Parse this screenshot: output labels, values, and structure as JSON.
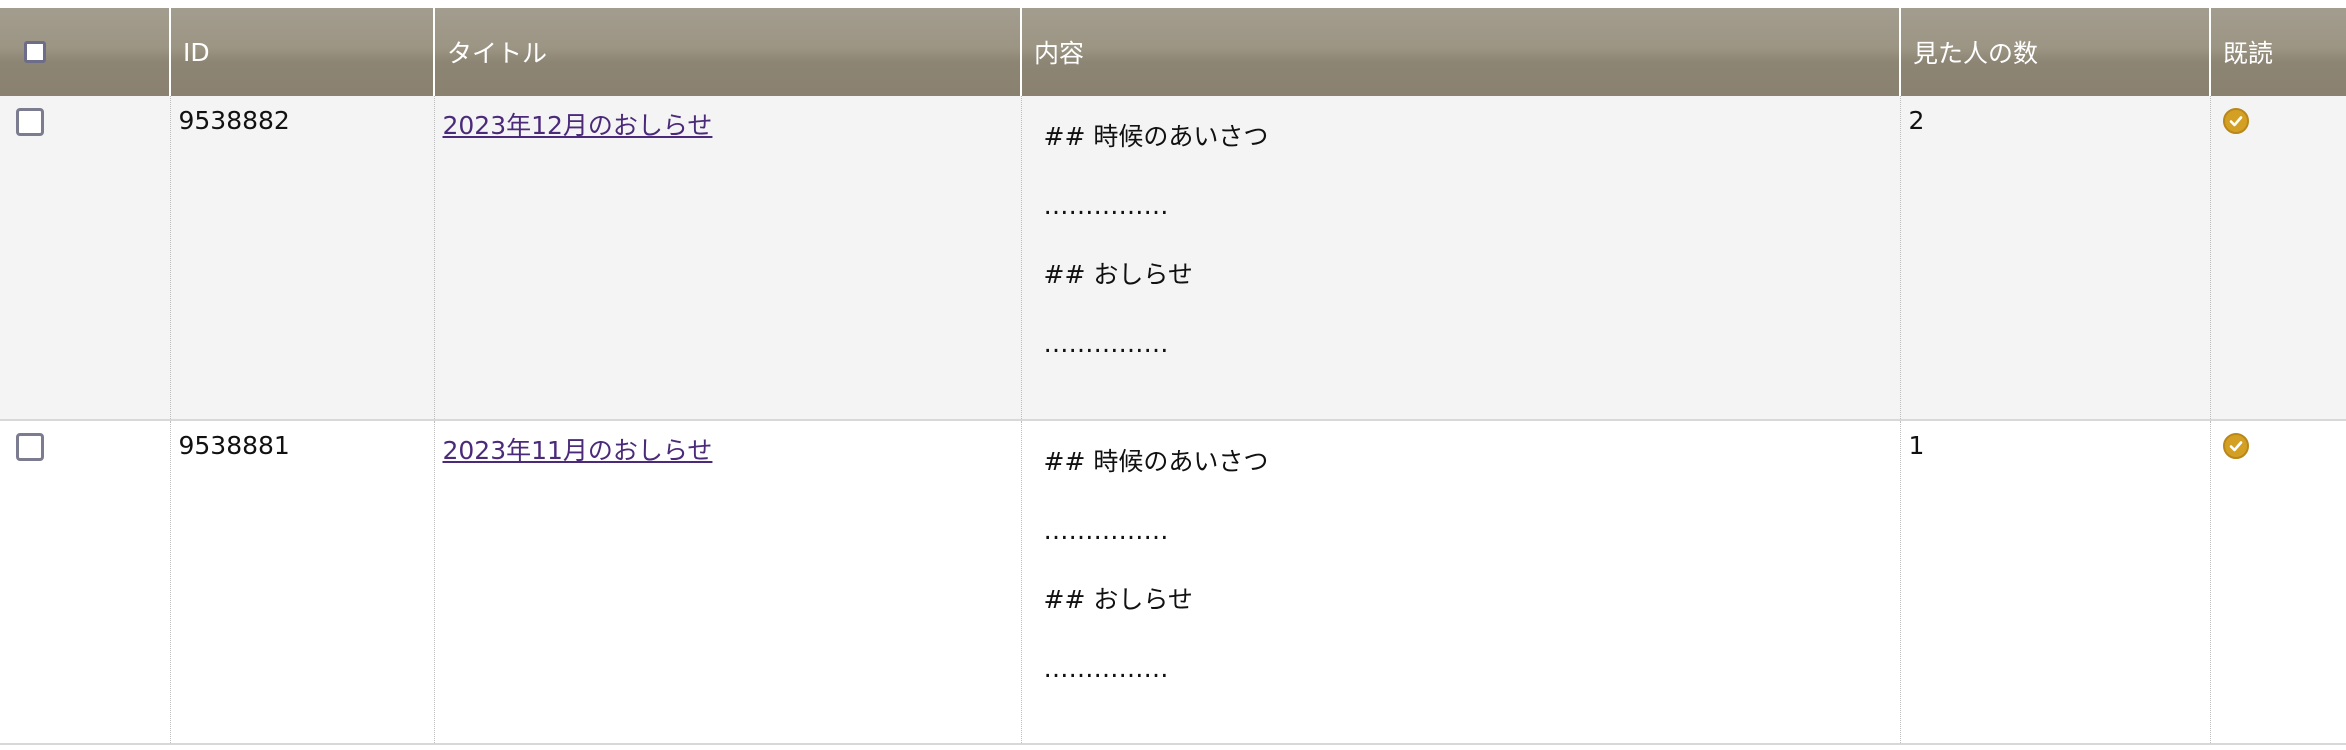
{
  "table": {
    "headers": {
      "id": "ID",
      "title": "タイトル",
      "content": "内容",
      "viewers": "見た人の数",
      "read": "既読"
    },
    "rows": [
      {
        "id": "9538882",
        "title": "2023年12月のおしらせ",
        "content": [
          "## 時候のあいさつ",
          "……………",
          "## おしらせ",
          "……………"
        ],
        "viewers": "2",
        "read": true
      },
      {
        "id": "9538881",
        "title": "2023年11月のおしらせ",
        "content": [
          "## 時候のあいさつ",
          "……………",
          "## おしらせ",
          "……………"
        ],
        "viewers": "1",
        "read": true
      }
    ]
  },
  "colors": {
    "header_bg": "#9c9584",
    "link": "#4b2a7a",
    "read_icon": "#d4a024",
    "row_alt_bg": "#f4f4f4"
  },
  "icons": {
    "read": "check-circle-icon"
  }
}
